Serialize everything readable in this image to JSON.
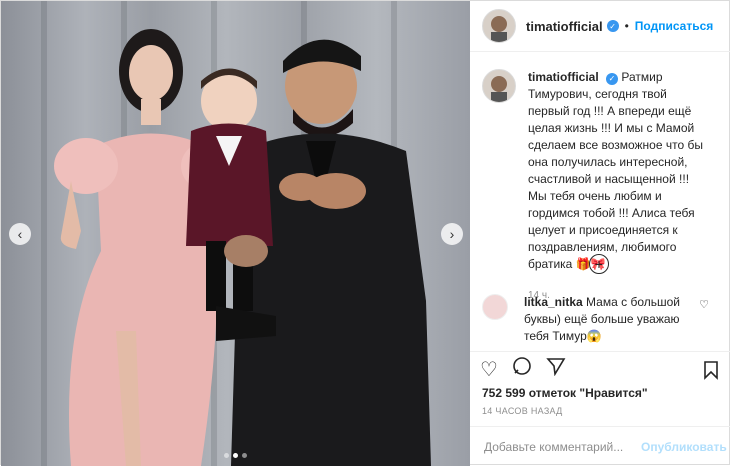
{
  "post": {
    "username": "timatiofficial",
    "follow_label": "Подписаться",
    "separator": "•",
    "caption": "Ратмир Тимурович, сегодня твой первый год !!! А впереди ещё целая жизнь !!! И мы с Мамой сделаем все возможное что бы она получилась интересной, счастливой и насыщенной !!! Мы тебя очень любим и гордимся тобой !!! Алиса тебя целует и присоединяется к поздравлениям, любимого братика 🎁🎀",
    "caption_time": "14 ч.",
    "likes": "752 599 отметок \"Нравится\"",
    "time_ago": "14 ЧАСОВ НАЗАД",
    "comment_placeholder": "Добавьте комментарий...",
    "publish_label": "Опубликовать"
  },
  "comment": {
    "username": "litka_nitka",
    "text": "Мама с большой буквы) ещё больше уважаю тебя Тимур😱"
  },
  "carousel": {
    "dots": 3,
    "active": 1
  },
  "colors": {
    "accent": "#0095f6",
    "verified": "#3897f0"
  }
}
